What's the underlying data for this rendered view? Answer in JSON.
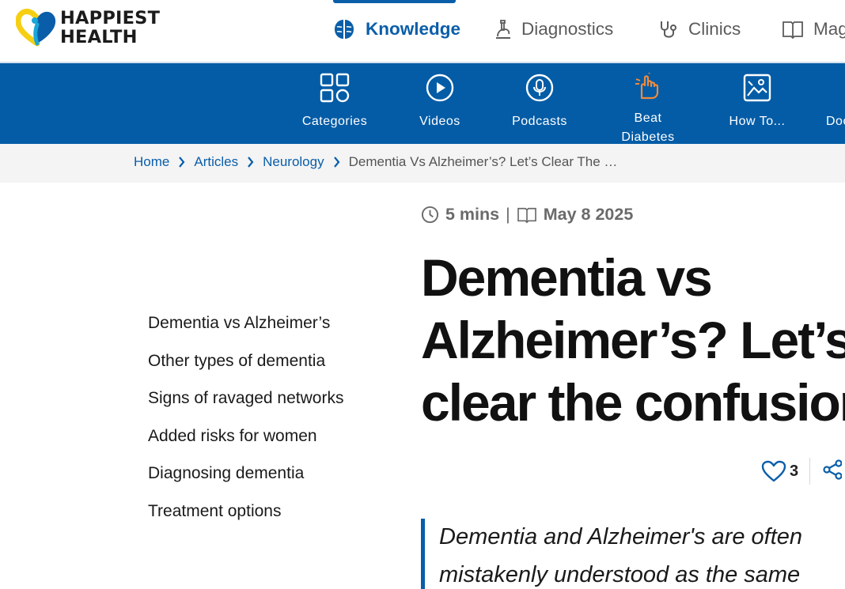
{
  "brand": {
    "line1": "HAPPIEST",
    "line2": "HEALTH"
  },
  "top_nav": [
    {
      "label": "Knowledge",
      "icon": "brain-icon",
      "active": true
    },
    {
      "label": "Diagnostics",
      "icon": "microscope-icon",
      "active": false
    },
    {
      "label": "Clinics",
      "icon": "stethoscope-icon",
      "active": false
    },
    {
      "label": "Mag",
      "icon": "book-icon",
      "active": false
    }
  ],
  "sub_nav": [
    {
      "label": "Categories",
      "icon": "grid-icon"
    },
    {
      "label": "Videos",
      "icon": "play-icon"
    },
    {
      "label": "Podcasts",
      "icon": "microphone-icon"
    },
    {
      "label_line1": "Beat",
      "label_line2": "Diabetes",
      "icon": "hand-icon"
    },
    {
      "label": "How To...",
      "icon": "image-icon"
    },
    {
      "label": "Doc",
      "icon": "document-icon"
    }
  ],
  "breadcrumb": [
    {
      "label": "Home"
    },
    {
      "label": "Articles"
    },
    {
      "label": "Neurology"
    },
    {
      "label": "Dementia Vs Alzheimer’s? Let’s Clear The …"
    }
  ],
  "toc": [
    "Dementia vs Alzheimer’s",
    "Other types of dementia",
    "Signs of ravaged networks",
    "Added risks for women",
    "Diagnosing dementia",
    "Treatment options"
  ],
  "article": {
    "read_time": "5 mins",
    "separator": "|",
    "date": "May 8 2025",
    "title_lines": [
      "Dementia vs",
      "Alzheimer’s? Let’s",
      "clear the confusion"
    ],
    "likes": "3",
    "summary_lines": [
      "Dementia and Alzheimer's are often",
      "mistakenly understood as the same"
    ]
  },
  "colors": {
    "brand_blue": "#0a5ea9",
    "nav_blue": "#045ca6",
    "accent_orange": "#f08a3a"
  }
}
